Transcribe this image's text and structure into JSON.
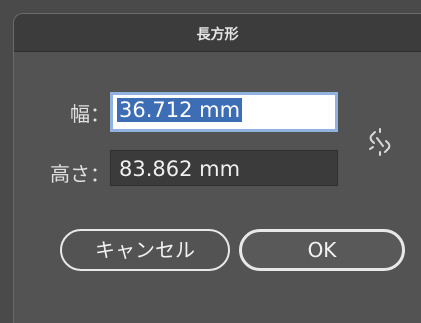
{
  "dialog": {
    "title": "長方形"
  },
  "width": {
    "label": "幅：",
    "value": "36.712 mm"
  },
  "height": {
    "label": "高さ：",
    "value": "83.862 mm"
  },
  "link_icon": "unlink-chain-icon",
  "buttons": {
    "cancel_label": "キャンセル",
    "ok_label": "OK"
  },
  "colors": {
    "background": "#535353",
    "titlebar": "#3c3c3c",
    "selection": "#3d6db5",
    "focus_ring": "#8fb2e0"
  }
}
